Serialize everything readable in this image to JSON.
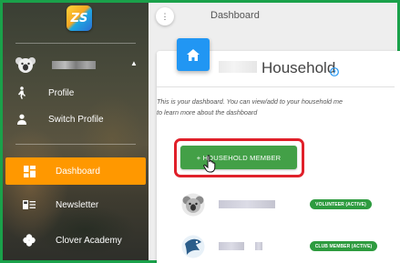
{
  "topbar": {
    "menu_icon": "more-vertical-icon",
    "title": "Dashboard"
  },
  "sidebar": {
    "logo_text": "ZS",
    "user_caret": "▲",
    "user_items": [
      {
        "label": "Profile",
        "icon": "person-walking-icon"
      },
      {
        "label": "Switch Profile",
        "icon": "person-icon"
      }
    ],
    "nav": [
      {
        "label": "Dashboard",
        "icon": "dashboard-icon",
        "active": true
      },
      {
        "label": "Newsletter",
        "icon": "newsletter-icon",
        "active": false
      },
      {
        "label": "Clover Academy",
        "icon": "clover-icon",
        "active": false
      }
    ]
  },
  "card": {
    "title": "Household",
    "description_line1": "This is your dashboard. You can view/add to your household me",
    "description_line2": "to learn more about the dashboard",
    "add_button_label": "+ HOUSEHOLD MEMBER"
  },
  "members": [
    {
      "badge": "VOLUNTEER (ACTIVE)"
    },
    {
      "badge": "CLUB MEMBER (ACTIVE)"
    }
  ],
  "colors": {
    "accent_orange": "#ff9800",
    "primary_blue": "#2196f3",
    "button_green": "#43a047",
    "badge_green": "#2e9b3f",
    "highlight_red": "#e0202a",
    "frame_green": "#1aa14a"
  }
}
